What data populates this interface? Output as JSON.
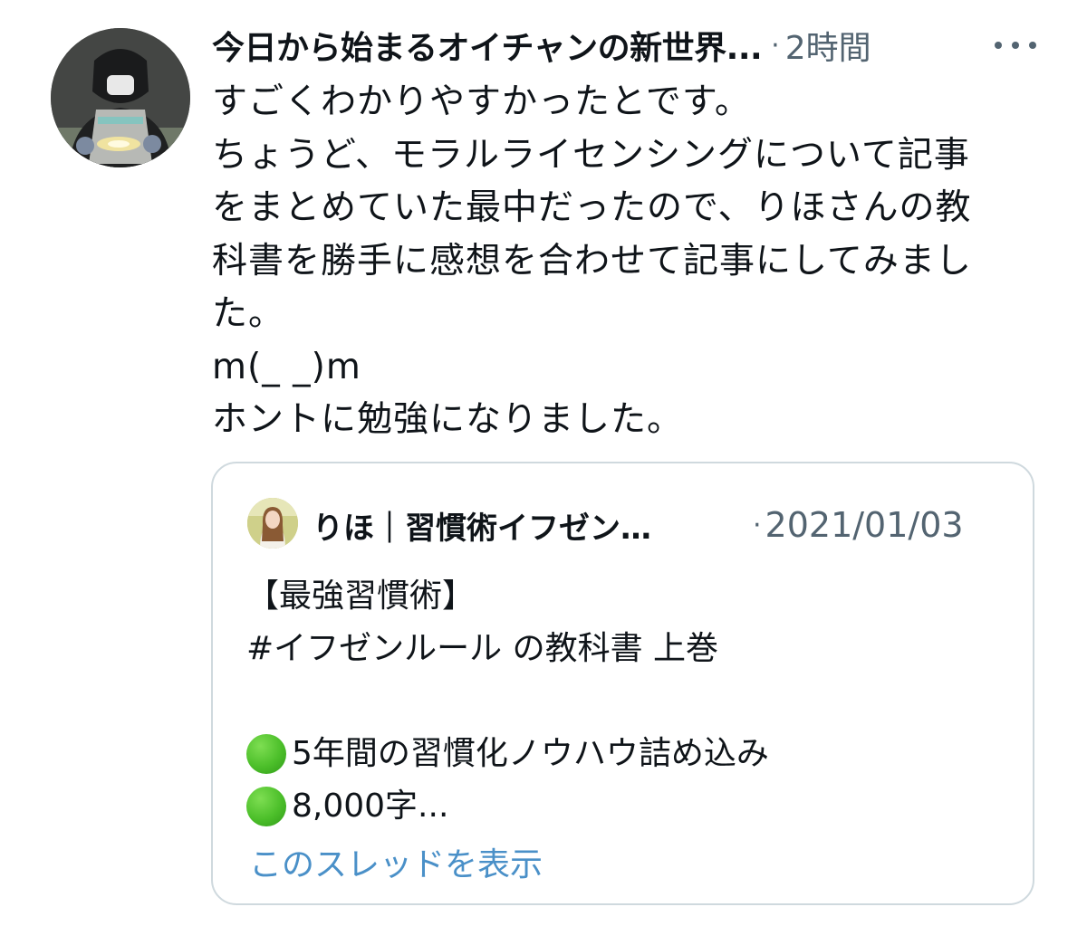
{
  "tweet": {
    "author_name": "今日から始まるオイチャンの新世界...",
    "separator": "·",
    "time": "2時間",
    "more_icon": "ellipsis-icon",
    "body_lines": [
      "すごくわかりやすかったとです。",
      "ちょうど、モラルライセンシングについて記事",
      "をまとめていた最中だったので、りほさんの教",
      "科書を勝手に感想を合わせて記事にしてみまし",
      "た。",
      "m(_ _)m",
      "ホントに勉強になりました。"
    ]
  },
  "quote": {
    "author_name": "りほ｜習慣術イフゼン…",
    "separator": "·",
    "date": "2021/01/03",
    "lines": [
      "【最強習慣術】",
      "#イフゼンルール の教科書 上巻",
      "",
      "5年間の習慣化ノウハウ詰め込み",
      "8,000字..."
    ],
    "bullet_icon": "green-circle-icon",
    "show_thread_label": "このスレッドを表示"
  }
}
